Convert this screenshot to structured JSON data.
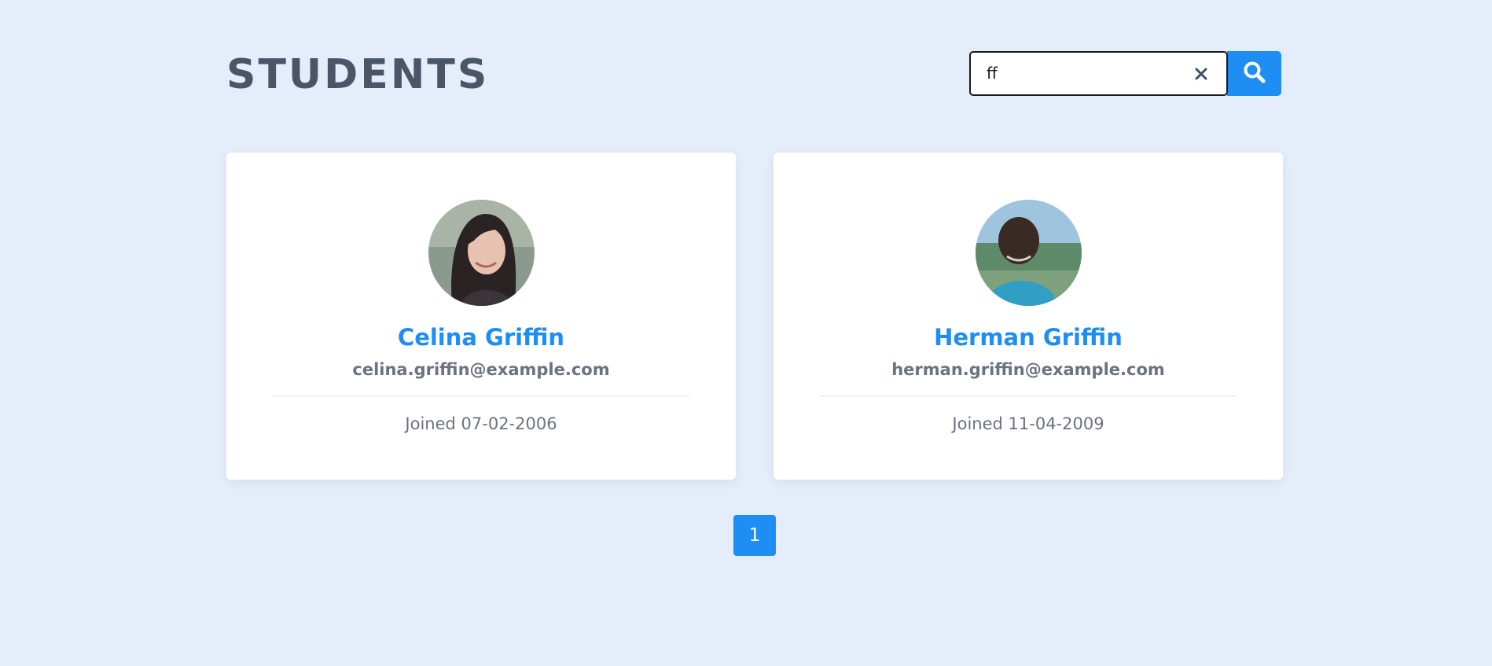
{
  "header": {
    "title": "STUDENTS"
  },
  "search": {
    "value": "ff",
    "clear_icon": "close-icon",
    "button_icon": "search-icon"
  },
  "students": [
    {
      "name": "Celina Griffin",
      "email": "celina.griffin@example.com",
      "joined": "Joined 07-02-2006",
      "avatar": "portrait-photo"
    },
    {
      "name": "Herman Griffin",
      "email": "herman.griffin@example.com",
      "joined": "Joined 11-04-2009",
      "avatar": "portrait-photo"
    }
  ],
  "pagination": {
    "current_page": "1"
  },
  "colors": {
    "background": "#e4edf9",
    "accent": "#1e8ef5",
    "title": "#4a5568",
    "muted": "#6b7280"
  }
}
